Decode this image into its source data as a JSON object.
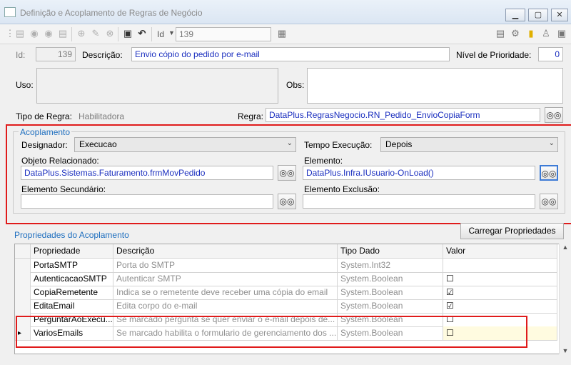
{
  "window": {
    "title": "Definição e Acoplamento de Regras de Negócio"
  },
  "toolbar": {
    "id_label": "Id",
    "id_value": "139"
  },
  "header": {
    "id_label": "Id:",
    "id_value": "139",
    "descricao_label": "Descrição:",
    "descricao_value": "Envio cópio do pedido por e-mail",
    "prioridade_label": "Nível de Prioridade:",
    "prioridade_value": "0",
    "uso_label": "Uso:",
    "obs_label": "Obs:",
    "tipo_label": "Tipo de Regra:",
    "tipo_value": "Habilitadora",
    "regra_label": "Regra:",
    "regra_value": "DataPlus.RegrasNegocio.RN_Pedido_EnvioCopiaForm"
  },
  "acoplamento": {
    "title": "Acoplamento",
    "designador_label": "Designador:",
    "designador_value": "Execucao",
    "tempo_label": "Tempo Execução:",
    "tempo_value": "Depois",
    "objeto_label": "Objeto Relacionado:",
    "objeto_value": "DataPlus.Sistemas.Faturamento.frmMovPedido",
    "elemento_label": "Elemento:",
    "elemento_value": "DataPlus.Infra.IUsuario-OnLoad()",
    "secundario_label": "Elemento Secundário:",
    "secundario_value": "",
    "exclusao_label": "Elemento Exclusão:",
    "exclusao_value": ""
  },
  "propriedades": {
    "title": "Propriedades do Acoplamento",
    "carregar_label": "Carregar Propriedades",
    "columns": [
      "Propriedade",
      "Descrição",
      "Tipo Dado",
      "Valor"
    ],
    "rows": [
      {
        "prop": "PortaSMTP",
        "desc": "Porta do SMTP",
        "tipo": "System.Int32",
        "valor": ""
      },
      {
        "prop": "AutenticacaoSMTP",
        "desc": "Autenticar SMTP",
        "tipo": "System.Boolean",
        "valor": "☐"
      },
      {
        "prop": "CopiaRemetente",
        "desc": "Indica se o remetente deve receber uma cópia do email",
        "tipo": "System.Boolean",
        "valor": "☑"
      },
      {
        "prop": "EditaEmail",
        "desc": "Edita corpo do e-mail",
        "tipo": "System.Boolean",
        "valor": "☑"
      },
      {
        "prop": "PerguntarAoExecu...",
        "desc": "Se marcado pergunta se quer enviar o e-mail depois de...",
        "tipo": "System.Boolean",
        "valor": "☐"
      },
      {
        "prop": "VariosEmails",
        "desc": "Se marcado habilita o formulario de gerenciamento dos ...",
        "tipo": "System.Boolean",
        "valor": "☐"
      }
    ]
  },
  "colors": {
    "highlight": "#e01b1b",
    "link_text": "#1b2fbf",
    "group_title": "#1f6fbf"
  }
}
